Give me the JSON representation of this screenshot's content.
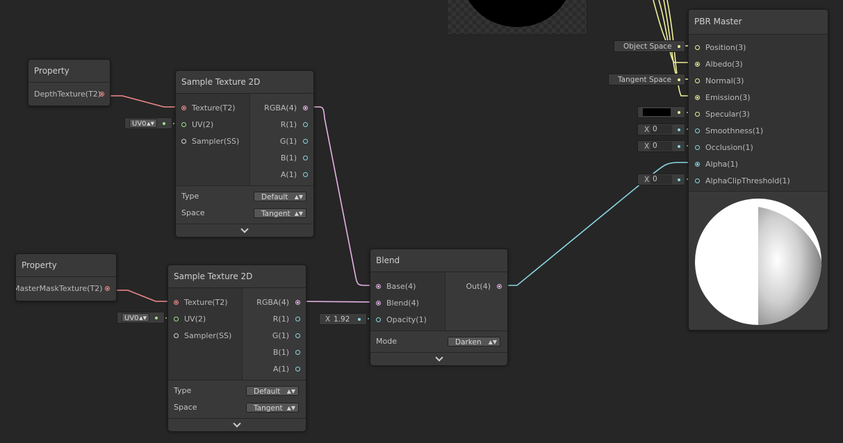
{
  "preview_top": {
    "shape": "black-sphere-preview"
  },
  "property_1": {
    "title": "Property",
    "output_label": "DepthTexture(T2)"
  },
  "property_2": {
    "title": "Property",
    "output_label": "MasterMaskTexture(T2)"
  },
  "sample_1": {
    "title": "Sample Texture 2D",
    "inputs": [
      "Texture(T2)",
      "UV(2)",
      "Sampler(SS)"
    ],
    "outputs": [
      "RGBA(4)",
      "R(1)",
      "G(1)",
      "B(1)",
      "A(1)"
    ],
    "uv_value": "UV0",
    "type_label": "Type",
    "type_value": "Default",
    "space_label": "Space",
    "space_value": "Tangent"
  },
  "sample_2": {
    "title": "Sample Texture 2D",
    "inputs": [
      "Texture(T2)",
      "UV(2)",
      "Sampler(SS)"
    ],
    "outputs": [
      "RGBA(4)",
      "R(1)",
      "G(1)",
      "B(1)",
      "A(1)"
    ],
    "uv_value": "UV0",
    "type_label": "Type",
    "type_value": "Default",
    "space_label": "Space",
    "space_value": "Tangent"
  },
  "blend": {
    "title": "Blend",
    "inputs": [
      "Base(4)",
      "Blend(4)",
      "Opacity(1)"
    ],
    "output": "Out(4)",
    "opacity_axis": "X",
    "opacity_value": "1.92",
    "mode_label": "Mode",
    "mode_value": "Darken"
  },
  "master": {
    "title": "PBR Master",
    "inputs": [
      "Position(3)",
      "Albedo(3)",
      "Normal(3)",
      "Emission(3)",
      "Specular(3)",
      "Smoothness(1)",
      "Occlusion(1)",
      "Alpha(1)",
      "AlphaClipThreshold(1)"
    ],
    "position_space": "Object Space",
    "normal_space": "Tangent Space",
    "specular_color": "#000000",
    "smoothness_axis": "X",
    "smoothness_value": "0",
    "occlusion_axis": "X",
    "occlusion_value": "0",
    "alphaclip_axis": "X",
    "alphaclip_value": "0"
  },
  "colors": {
    "texture": "#f08a8a",
    "vector4": "#e6b3e6",
    "vector1": "#8ad7e4",
    "vector2": "#9ce48a",
    "vector3": "#f0f09c"
  }
}
